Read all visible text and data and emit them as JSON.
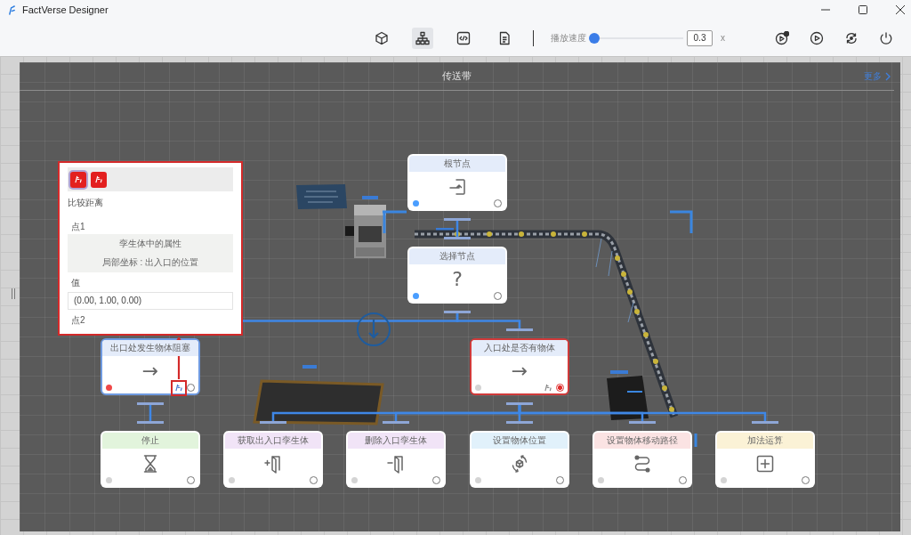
{
  "window": {
    "title": "FactVerse Designer"
  },
  "toolbar": {
    "views": [
      {
        "kind": "cube",
        "selected": false
      },
      {
        "kind": "hierarchy",
        "selected": true
      },
      {
        "kind": "code",
        "selected": false
      },
      {
        "kind": "document",
        "selected": false
      }
    ],
    "speed": {
      "label": "播放速度",
      "level": 0.05,
      "value": "0.3",
      "unit": "x"
    },
    "actions": [
      {
        "kind": "play-alert"
      },
      {
        "kind": "play"
      },
      {
        "kind": "restart"
      },
      {
        "kind": "power"
      }
    ]
  },
  "scene": {
    "title": "传送带",
    "link": "更多"
  },
  "tree": {
    "title": "根节点",
    "kind": "root",
    "color": "#e4ecfa",
    "port": {
      "color": "#4a9eff"
    },
    "selected": false,
    "highlighted": false,
    "children": [
      {
        "title": "选择节点",
        "kind": "selector",
        "symbol": "?",
        "color": "#e4ecfa",
        "port": {
          "color": "#4a9eff"
        },
        "selected": false,
        "highlighted": false,
        "children": [
          {
            "title": "出口处发生物体阻塞",
            "kind": "condition",
            "symbol": "→",
            "color": "#e4ecfa",
            "port": {
              "color": "#f04848"
            },
            "selected": true,
            "highlighted": false,
            "children": [
              {
                "title": "停止",
                "kind": "wait",
                "color": "#e2f4dc",
                "port": {
                  "color": "#d4d4d4"
                },
                "selected": false,
                "highlighted": false
              }
            ]
          },
          {
            "title": "入口处是否有物体",
            "kind": "condition",
            "symbol": "→",
            "color": "#e4ecfa",
            "port": {
              "color": "#d4d4d4"
            },
            "selected": false,
            "highlighted": true,
            "children": [
              {
                "title": "获取出入口孪生体",
                "kind": "get-twin",
                "color": "#f1e4f7",
                "port": {
                  "color": "#d4d4d4"
                },
                "selected": false,
                "highlighted": false
              },
              {
                "title": "删除入口孪生体",
                "kind": "remove-twin",
                "color": "#f1e4f7",
                "port": {
                  "color": "#d4d4d4"
                },
                "selected": false,
                "highlighted": false
              },
              {
                "title": "设置物体位置",
                "kind": "set-position",
                "color": "#e1f1fb",
                "port": {
                  "color": "#d4d4d4"
                },
                "selected": false,
                "highlighted": false
              },
              {
                "title": "设置物体移动路径",
                "kind": "set-path",
                "color": "#fbe3e3",
                "port": {
                  "color": "#d4d4d4"
                },
                "selected": false,
                "highlighted": false
              },
              {
                "title": "加法运算",
                "kind": "add",
                "color": "#fbf2d6",
                "port": {
                  "color": "#d4d4d4"
                },
                "selected": false,
                "highlighted": false
              }
            ]
          }
        ]
      }
    ]
  },
  "panel": {
    "tabs": [
      {
        "selected": true
      },
      {
        "selected": false
      }
    ],
    "title": "比较距离",
    "items": [
      {
        "kind": "label",
        "text": "点1"
      },
      {
        "kind": "info",
        "lines": [
          "孪生体中的属性",
          "局部坐标 : 出入口的位置"
        ]
      },
      {
        "kind": "label",
        "text": "值"
      },
      {
        "kind": "input",
        "value": "(0.00, 1.00, 0.00)"
      },
      {
        "kind": "label",
        "text": "点2"
      }
    ]
  }
}
